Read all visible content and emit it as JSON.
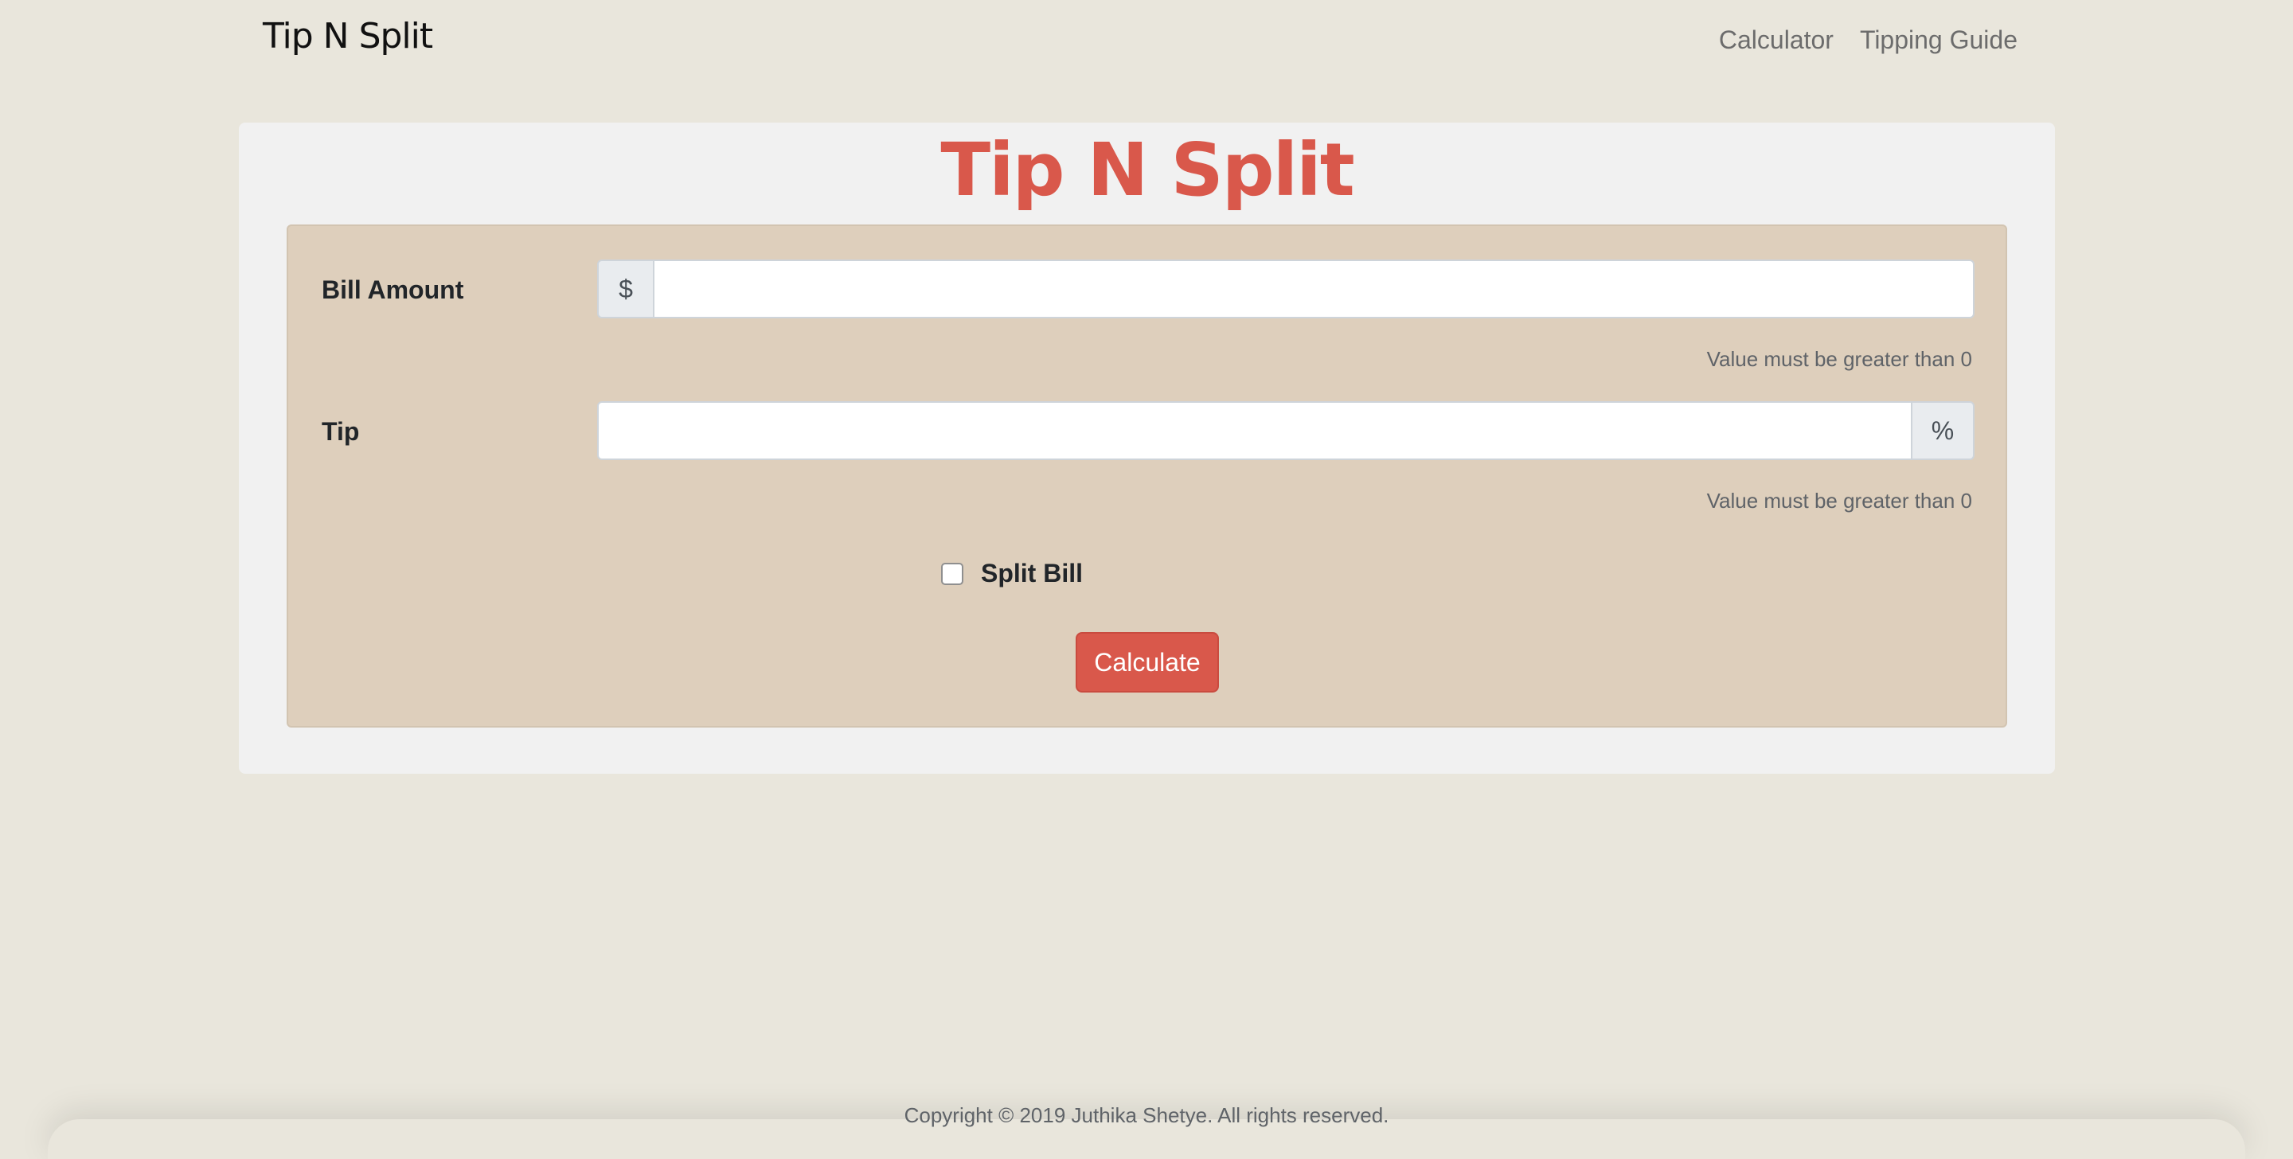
{
  "navbar": {
    "brand": "Tip N Split",
    "links": [
      "Calculator",
      "Tipping Guide"
    ]
  },
  "main": {
    "title": "Tip N Split",
    "bill": {
      "label": "Bill Amount",
      "prefix": "$",
      "value": "",
      "help": "Value must be greater than 0"
    },
    "tip": {
      "label": "Tip",
      "suffix": "%",
      "value": "",
      "help": "Value must be greater than 0"
    },
    "split": {
      "label": "Split Bill",
      "checked": false
    },
    "calculate_label": "Calculate"
  },
  "footer": {
    "text": "Copyright © 2019 Juthika Shetye. All rights reserved."
  },
  "colors": {
    "page_bg": "#e9e6dc",
    "card_bg": "#f1f1f1",
    "panel_bg": "#decfbc",
    "accent": "#d9584b"
  }
}
